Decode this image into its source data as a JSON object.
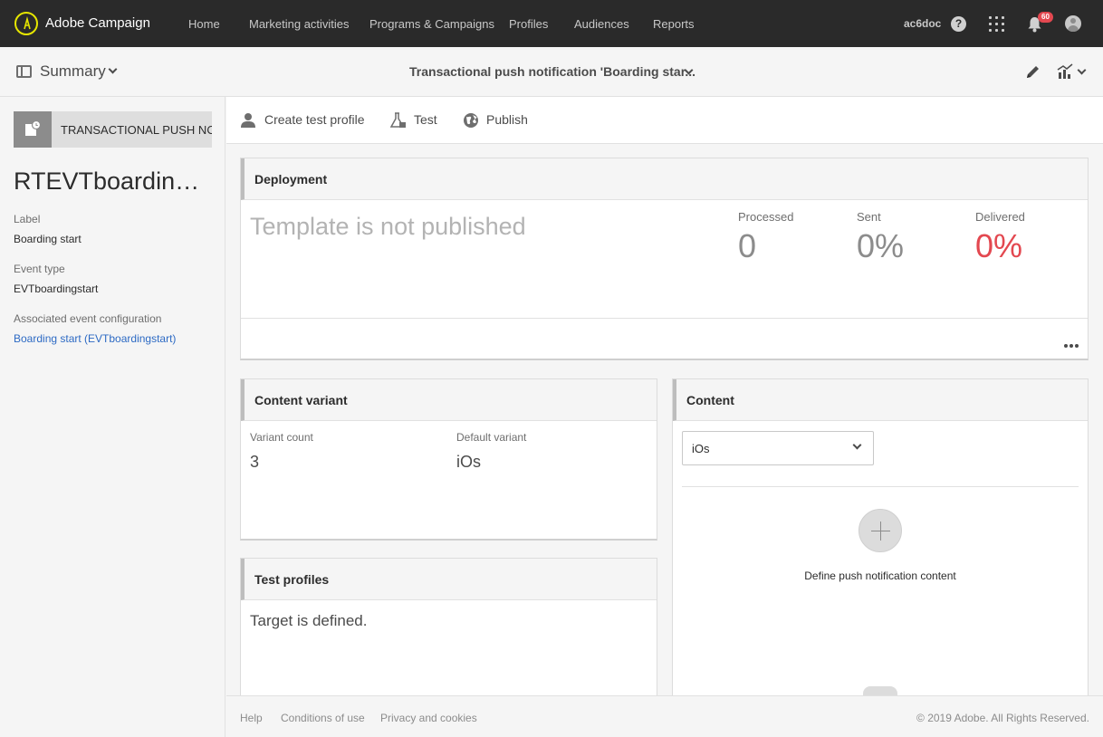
{
  "app": {
    "title": "Adobe Campaign",
    "user_id": "ac6doc",
    "notification_count": "60",
    "accent_color": "#e34850"
  },
  "nav": {
    "items": [
      {
        "label": "Home"
      },
      {
        "label": "Marketing activities"
      },
      {
        "label": "Programs & Campaigns"
      },
      {
        "label": "Profiles"
      },
      {
        "label": "Audiences"
      },
      {
        "label": "Reports"
      }
    ]
  },
  "subheader": {
    "summary_label": "Summary",
    "page_title": "Transactional push notification 'Boarding star..."
  },
  "left_panel": {
    "type_label": "TRANSACTIONAL PUSH NOTIFICATION",
    "entity_name": "RTEVTboardingstart",
    "fields": [
      {
        "label": "Label",
        "value": "Boarding start"
      },
      {
        "label": "Event type",
        "value": "EVTboardingstart"
      },
      {
        "label": "Associated event configuration",
        "value": "Boarding start (EVTboardingstart)"
      }
    ]
  },
  "toolbar": {
    "create_test_profile": "Create test profile",
    "test": "Test",
    "publish": "Publish"
  },
  "deployment": {
    "title": "Deployment",
    "status": "Template is not published",
    "metrics": [
      {
        "label": "Processed",
        "value": "0"
      },
      {
        "label": "Sent",
        "value": "0%"
      },
      {
        "label": "Delivered",
        "value": "0%"
      }
    ]
  },
  "content_variant": {
    "title": "Content variant",
    "variant_count_label": "Variant count",
    "variant_count": "3",
    "default_variant_label": "Default variant",
    "default_variant": "iOs"
  },
  "test_profiles": {
    "title": "Test profiles",
    "status": "Target is defined."
  },
  "content": {
    "title": "Content",
    "selected_platform": "iOs",
    "define_text": "Define push notification content"
  },
  "footer": {
    "help": "Help",
    "conditions": "Conditions of use",
    "privacy": "Privacy and cookies",
    "copyright": "© 2019 Adobe. All Rights Reserved."
  }
}
